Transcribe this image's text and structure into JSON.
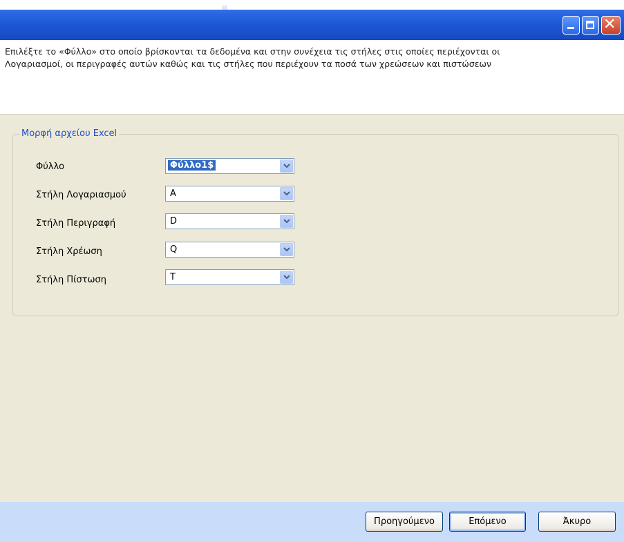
{
  "window": {
    "title": "",
    "controls": {
      "minimize_icon": "minimize-icon",
      "maximize_icon": "maximize-icon",
      "close_icon": "close-icon"
    }
  },
  "instructions": {
    "line1": "Επιλέξτε το «Φύλλο» στο οποίο βρίσκονται τα δεδομένα και στην συνέχεια τις στήλες στις οποίες περιέχονται οι",
    "line2": "Λογαριασμοί, οι περιγραφές αυτών καθώς και τις στήλες που περιέχουν τα ποσά των χρεώσεων και πιστώσεων"
  },
  "group": {
    "legend": "Μορφή αρχείου Excel",
    "fields": [
      {
        "label": "Φύλλο",
        "value": "Φύλλο1$"
      },
      {
        "label": "Στήλη Λογαριασμού",
        "value": "A"
      },
      {
        "label": "Στήλη Περιγραφή",
        "value": "D"
      },
      {
        "label": "Στήλη Χρέωση",
        "value": "Q"
      },
      {
        "label": "Στήλη Πίστωση",
        "value": "T"
      }
    ]
  },
  "footer": {
    "previous_label": "Προηγούμενο",
    "next_label": "Επόμενο",
    "cancel_label": "Άκυρο"
  },
  "colors": {
    "title_bar": "#1f5ad8",
    "panel_bg": "#ece9d8",
    "footer_bg": "#c9ddfb",
    "legend_text": "#1c4fc8",
    "selection": "#316ac5"
  }
}
